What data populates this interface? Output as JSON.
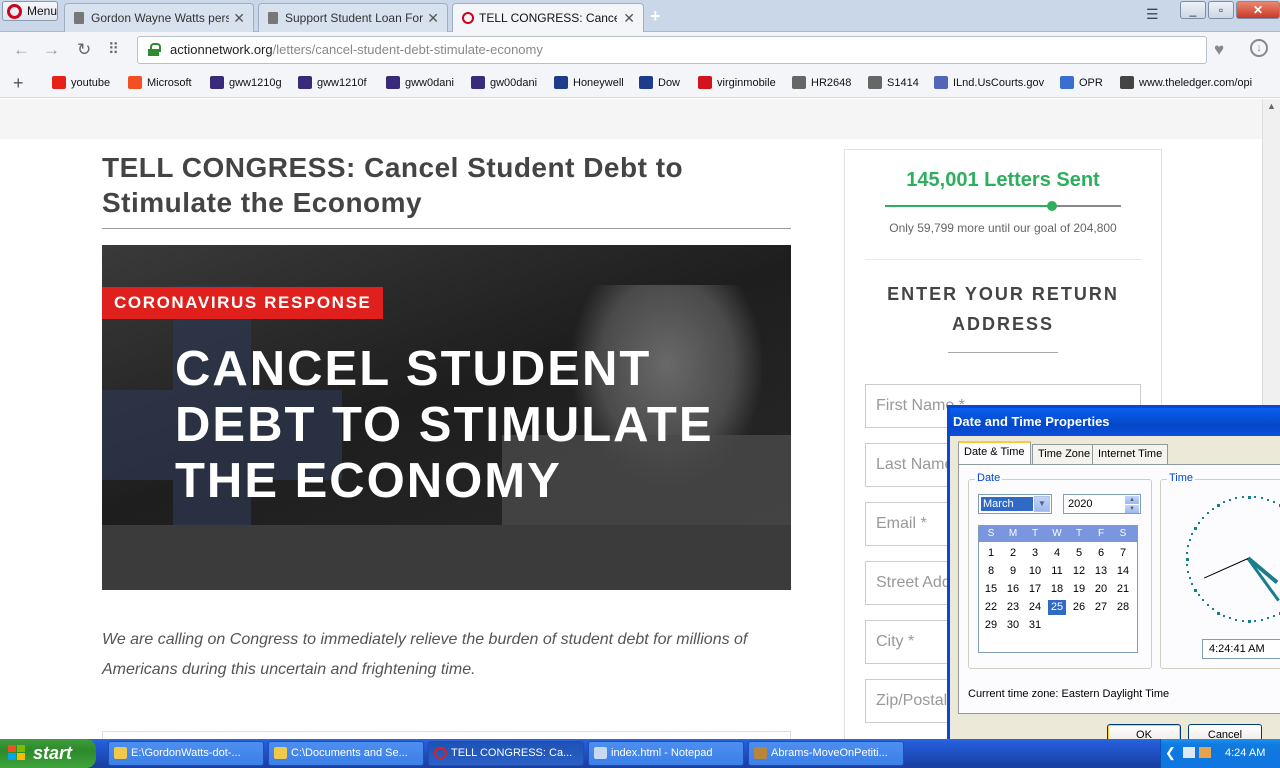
{
  "browser": {
    "menu_label": "Menu",
    "tabs": [
      {
        "label": "Gordon Wayne Watts perso"
      },
      {
        "label": "Support Student Loan Forgiv"
      },
      {
        "label": "TELL CONGRESS: Cancel Stu"
      }
    ],
    "url_domain": "actionnetwork.org",
    "url_path": "/letters/cancel-student-debt-stimulate-economy",
    "bookmarks": [
      {
        "label": "youtube",
        "color": "#e62117"
      },
      {
        "label": "Microsoft",
        "color": "#f25022"
      },
      {
        "label": "gww1210g",
        "color": "#3a2a7a"
      },
      {
        "label": "gww1210f",
        "color": "#3a2a7a"
      },
      {
        "label": "gww0dani",
        "color": "#3a2a7a"
      },
      {
        "label": "gw00dani",
        "color": "#3a2a7a"
      },
      {
        "label": "Honeywell",
        "color": "#1d3c8a"
      },
      {
        "label": "Dow",
        "color": "#1d3c8a"
      },
      {
        "label": "virginmobile",
        "color": "#d4141c"
      },
      {
        "label": "HR2648",
        "color": "#666666"
      },
      {
        "label": "S1414",
        "color": "#666666"
      },
      {
        "label": "ILnd.UsCourts.gov",
        "color": "#5266b8"
      },
      {
        "label": "OPR",
        "color": "#3a6fd0"
      },
      {
        "label": "www.theledger.com/opi",
        "color": "#444444"
      }
    ]
  },
  "article": {
    "title": "TELL CONGRESS: Cancel Student Debt to Stimulate the Economy",
    "hero_badge": "CORONAVIRUS RESPONSE",
    "hero_headline": "CANCEL STUDENT DEBT TO STIMULATE THE ECONOMY",
    "intro": "We are calling on Congress to immediately relieve the burden of student debt for millions of Americans during this uncertain and frightening time."
  },
  "sidebar": {
    "letters_sent": "145,001 Letters Sent",
    "progress_fraction": 0.708,
    "goal_text": "Only 59,799 more until our goal of 204,800",
    "form_heading": "ENTER YOUR RETURN ADDRESS",
    "fields": [
      {
        "placeholder": "First Name *"
      },
      {
        "placeholder": "Last Name *"
      },
      {
        "placeholder": "Email *"
      },
      {
        "placeholder": "Street Address"
      },
      {
        "placeholder": "City *"
      },
      {
        "placeholder": "Zip/Postal"
      }
    ],
    "accent_color": "#2eaf5d"
  },
  "dialog": {
    "title": "Date and Time Properties",
    "tabs": [
      "Date & Time",
      "Time Zone",
      "Internet Time"
    ],
    "date_group": "Date",
    "time_group": "Time",
    "month": "March",
    "year": "2020",
    "weekdays": [
      "S",
      "M",
      "T",
      "W",
      "T",
      "F",
      "S"
    ],
    "days": [
      [
        "1",
        "2",
        "3",
        "4",
        "5",
        "6",
        "7"
      ],
      [
        "8",
        "9",
        "10",
        "11",
        "12",
        "13",
        "14"
      ],
      [
        "15",
        "16",
        "17",
        "18",
        "19",
        "20",
        "21"
      ],
      [
        "22",
        "23",
        "24",
        "25",
        "26",
        "27",
        "28"
      ],
      [
        "29",
        "30",
        "31",
        "",
        "",
        "",
        ""
      ]
    ],
    "selected_day": "25",
    "time": "4:24:41 AM",
    "time_zone": "Current time zone:  Eastern Daylight Time",
    "ok": "OK",
    "cancel": "Cancel"
  },
  "taskbar": {
    "start": "start",
    "tasks": [
      {
        "label": "E:\\GordonWatts-dot-..."
      },
      {
        "label": "C:\\Documents and Se..."
      },
      {
        "label": "TELL CONGRESS: Ca..."
      },
      {
        "label": "index.html - Notepad"
      },
      {
        "label": "Abrams-MoveOnPetiti..."
      }
    ],
    "clock": "4:24 AM"
  }
}
